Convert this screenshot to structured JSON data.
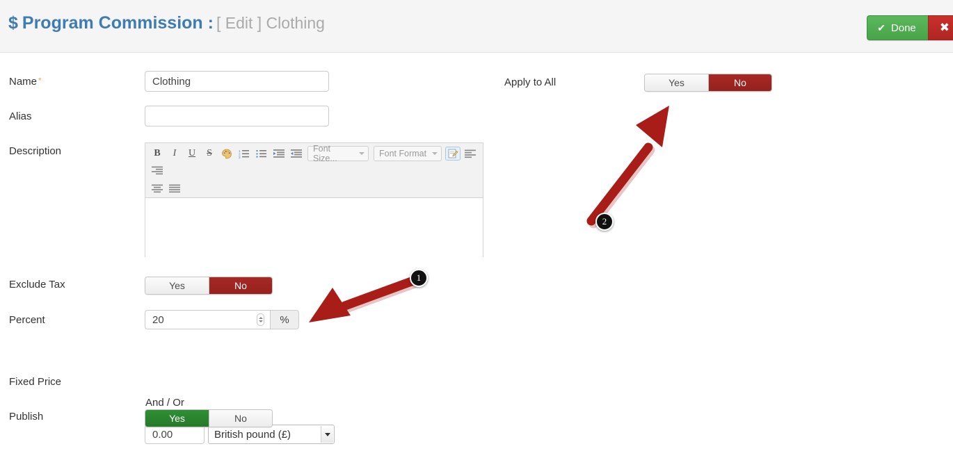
{
  "header": {
    "icon": "dollar-icon",
    "title": "Program Commission :",
    "subtitle": "[ Edit ] Clothing",
    "done_label": "Done",
    "done_icon": "check-icon",
    "cancel_icon": "close-icon",
    "cancel_label": "✖",
    "done_color": "#49a449",
    "cancel_color": "#ae2622",
    "title_color": "#3e7cb1",
    "subtitle_color": "#aaaaaa"
  },
  "form": {
    "name": {
      "label": "Name",
      "required_marker": "*",
      "value": "Clothing",
      "placeholder": ""
    },
    "alias": {
      "label": "Alias",
      "value": "",
      "placeholder": ""
    },
    "description": {
      "label": "Description",
      "value": "",
      "toolbar": {
        "bold": "B",
        "italic": "I",
        "underline": "U",
        "strikethrough": "S",
        "text_color": "palette-icon",
        "numbered_list": "ordered-list-icon",
        "bullet_list": "unordered-list-icon",
        "indent": "indent-icon",
        "outdent": "outdent-icon",
        "font_size": "Font Size...",
        "font_format": "Font Format",
        "source_edit": "edit-source-icon",
        "align_left": "align-left-icon",
        "align_right": "align-right-icon",
        "align_center": "align-center-icon",
        "justify": "align-justify-icon"
      }
    },
    "exclude_tax": {
      "label": "Exclude Tax",
      "yes_label": "Yes",
      "no_label": "No",
      "selected": "No"
    },
    "percent": {
      "label": "Percent",
      "value": "20",
      "unit": "%"
    },
    "and_or": "And / Or",
    "fixed_price": {
      "label": "Fixed Price",
      "value": "0.00",
      "currency": "British pound (£)"
    },
    "publish": {
      "label": "Publish",
      "yes_label": "Yes",
      "no_label": "No",
      "selected": "Yes"
    },
    "apply_to_all": {
      "label": "Apply to All",
      "yes_label": "Yes",
      "no_label": "No",
      "selected": "No"
    }
  },
  "annotations": {
    "color": "#a81d17",
    "items": [
      {
        "number": "1",
        "points_to": "percent-unit-button"
      },
      {
        "number": "2",
        "points_to": "apply-to-all-no-option"
      }
    ]
  }
}
